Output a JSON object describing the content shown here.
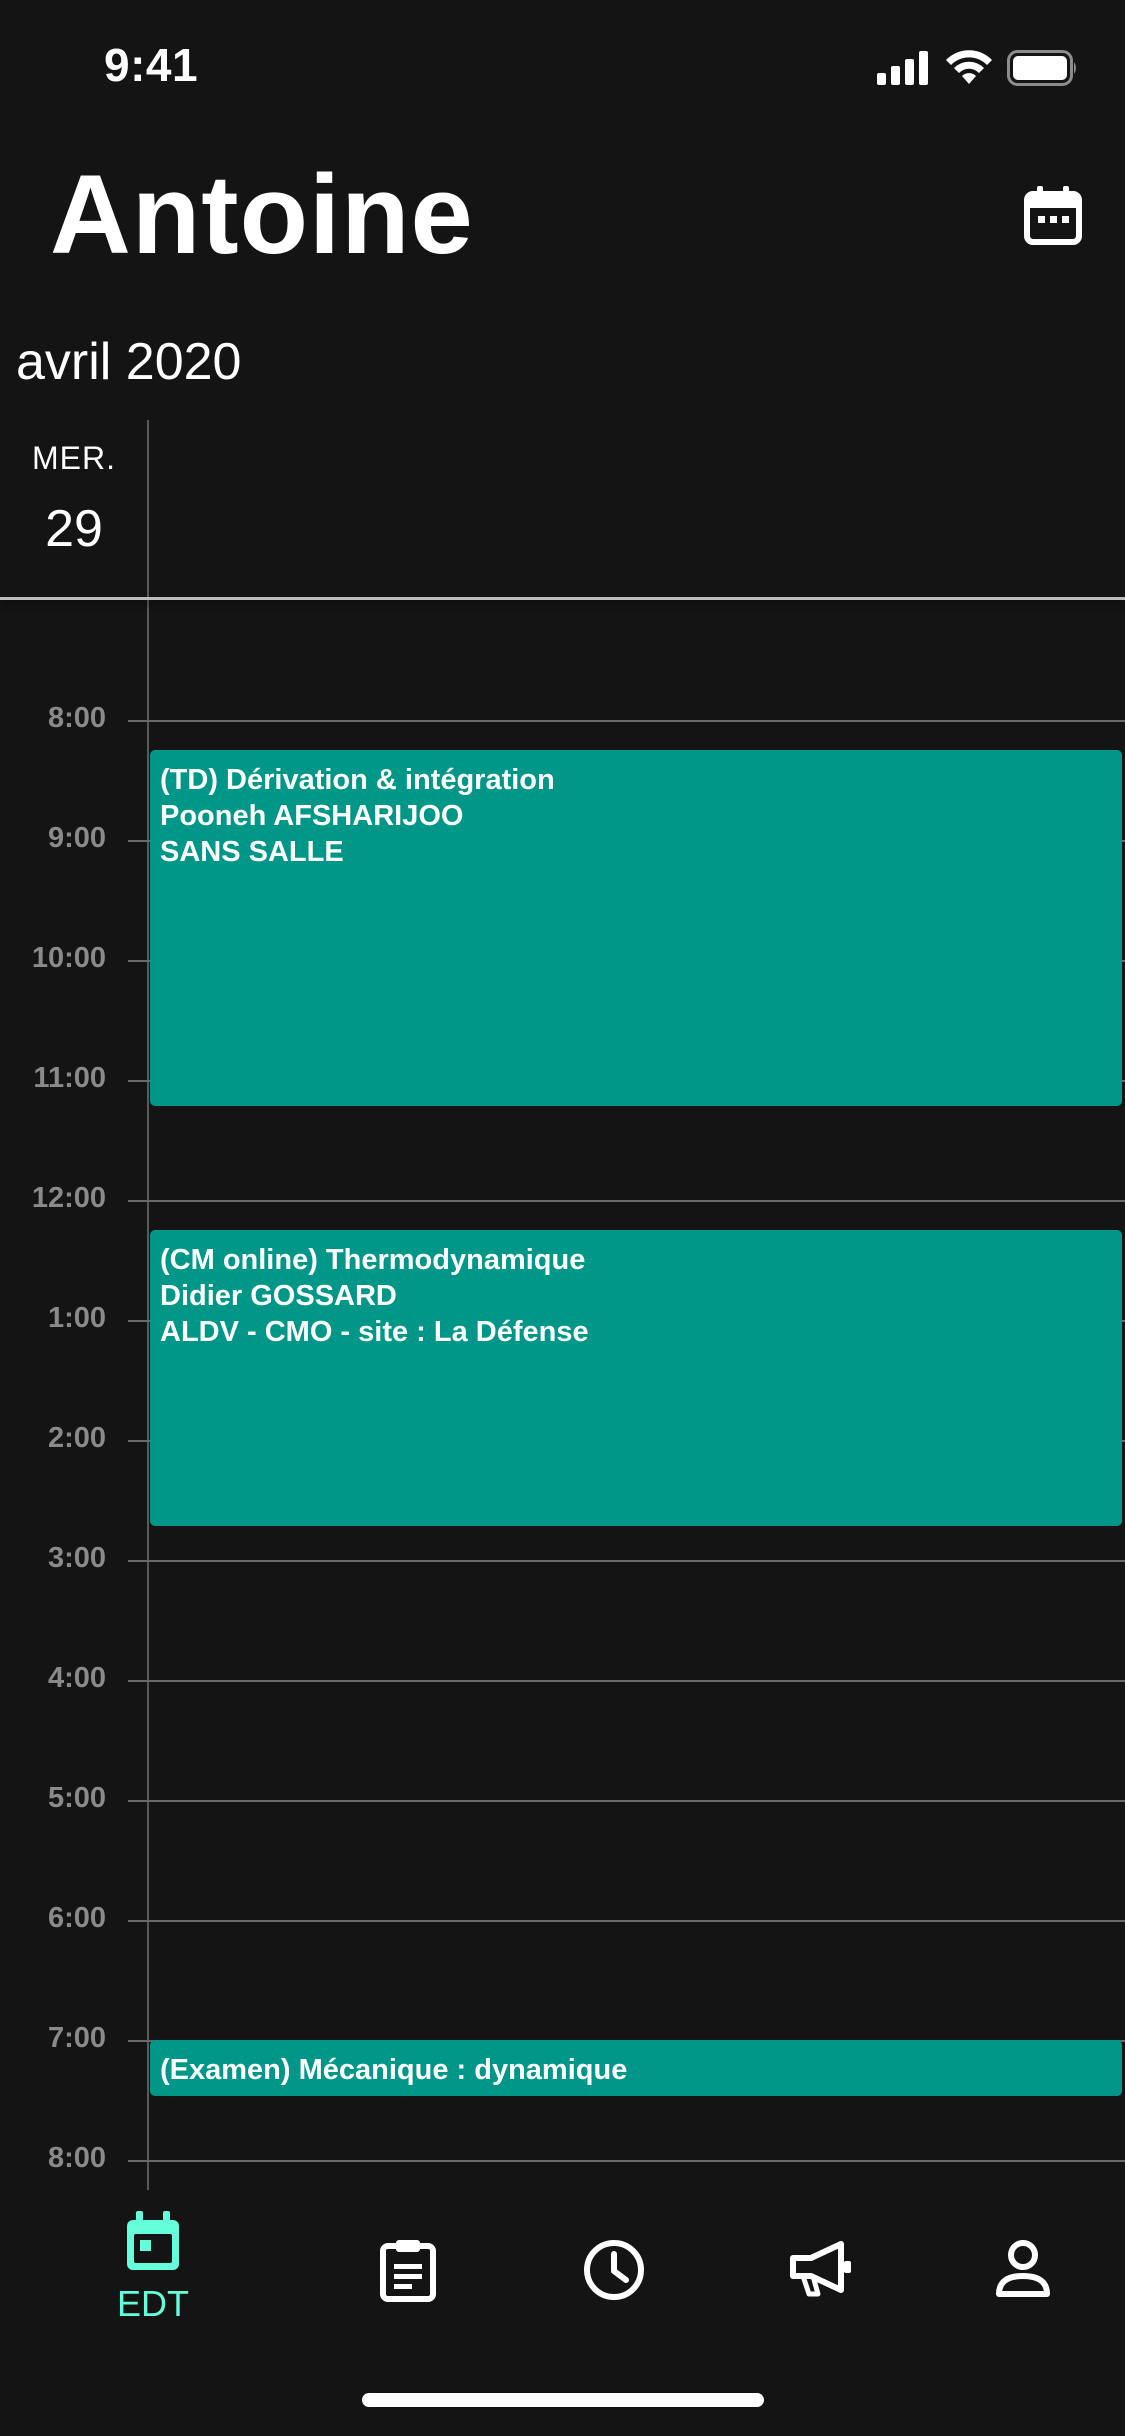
{
  "status_bar": {
    "time": "9:41",
    "icons": [
      "cellular-signal-icon",
      "wifi-icon",
      "battery-icon"
    ]
  },
  "header": {
    "title": "Antoine",
    "calendar_icon": "calendar-icon"
  },
  "month": "avril 2020",
  "day": {
    "name": "MER.",
    "number": "29"
  },
  "hours": [
    "8:00",
    "9:00",
    "10:00",
    "11:00",
    "12:00",
    "1:00",
    "2:00",
    "3:00",
    "4:00",
    "5:00",
    "6:00",
    "7:00",
    "8:00"
  ],
  "events": [
    {
      "title": "(TD) Dérivation & intégration",
      "teacher": "Pooneh AFSHARIJOO",
      "room": "SANS SALLE",
      "color": "#009688"
    },
    {
      "title": "(CM online) Thermodynamique",
      "teacher": "Didier GOSSARD",
      "room": "ALDV - CMO - site : La Défense",
      "color": "#009688"
    },
    {
      "title": "(Examen) Mécanique : dynamique",
      "color": "#009688"
    }
  ],
  "tab_bar": {
    "tabs": [
      {
        "icon": "calendar-icon",
        "label": "EDT",
        "active": true
      },
      {
        "icon": "clipboard-icon",
        "active": false
      },
      {
        "icon": "clock-icon",
        "active": false
      },
      {
        "icon": "megaphone-icon",
        "active": false
      },
      {
        "icon": "person-icon",
        "active": false
      }
    ],
    "active_color": "#64ffda"
  }
}
